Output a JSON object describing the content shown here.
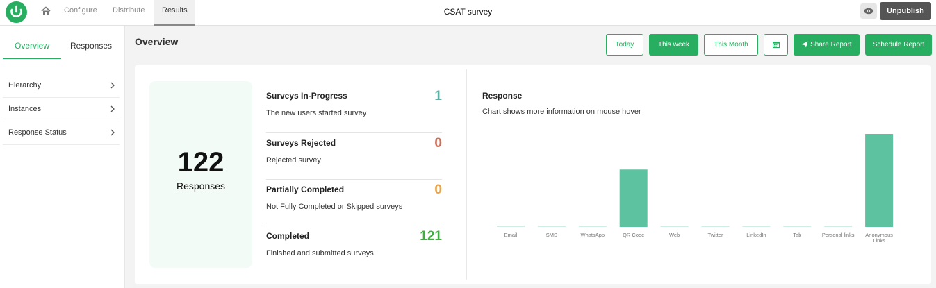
{
  "nav": {
    "configure": "Configure",
    "distribute": "Distribute",
    "results": "Results"
  },
  "header": {
    "title": "CSAT survey",
    "unpublish": "Unpublish"
  },
  "sidebar": {
    "tabs": {
      "overview": "Overview",
      "responses": "Responses"
    },
    "items": [
      {
        "label": "Hierarchy"
      },
      {
        "label": "Instances"
      },
      {
        "label": "Response Status"
      }
    ]
  },
  "main": {
    "title": "Overview",
    "filters": {
      "today": "Today",
      "this_week": "This week",
      "this_month": "This Month"
    },
    "share_report": "Share Report",
    "schedule_report": "Schedule Report"
  },
  "summary": {
    "total": "122",
    "total_label": "Responses",
    "stats": [
      {
        "name": "Surveys In-Progress",
        "desc": "The new users started survey",
        "value": "1",
        "color": "#5bb3a6"
      },
      {
        "name": "Surveys Rejected",
        "desc": "Rejected survey",
        "value": "0",
        "color": "#c9705d"
      },
      {
        "name": "Partially Completed",
        "desc": "Not Fully Completed or Skipped surveys",
        "value": "0",
        "color": "#e8a34d"
      },
      {
        "name": "Completed",
        "desc": "Finished and submitted surveys",
        "value": "121",
        "color": "#3fae3f"
      }
    ]
  },
  "response": {
    "title": "Response",
    "subtitle": "Chart shows more information on mouse hover"
  },
  "chart_data": {
    "type": "bar",
    "categories": [
      "Email",
      "SMS",
      "WhatsApp",
      "QR Code",
      "Web",
      "Twitter",
      "LinkedIn",
      "Tab",
      "Personal links",
      "Anonymous Links"
    ],
    "values": [
      0,
      0,
      0,
      50,
      0,
      0,
      0,
      0,
      0,
      81
    ],
    "ylim": [
      0,
      81
    ],
    "grid": false,
    "bar_color": "#5cc29f",
    "baseline_color": "#cfeee2"
  },
  "colors": {
    "accent": "#27ae60",
    "unpublish_bg": "#555555"
  }
}
